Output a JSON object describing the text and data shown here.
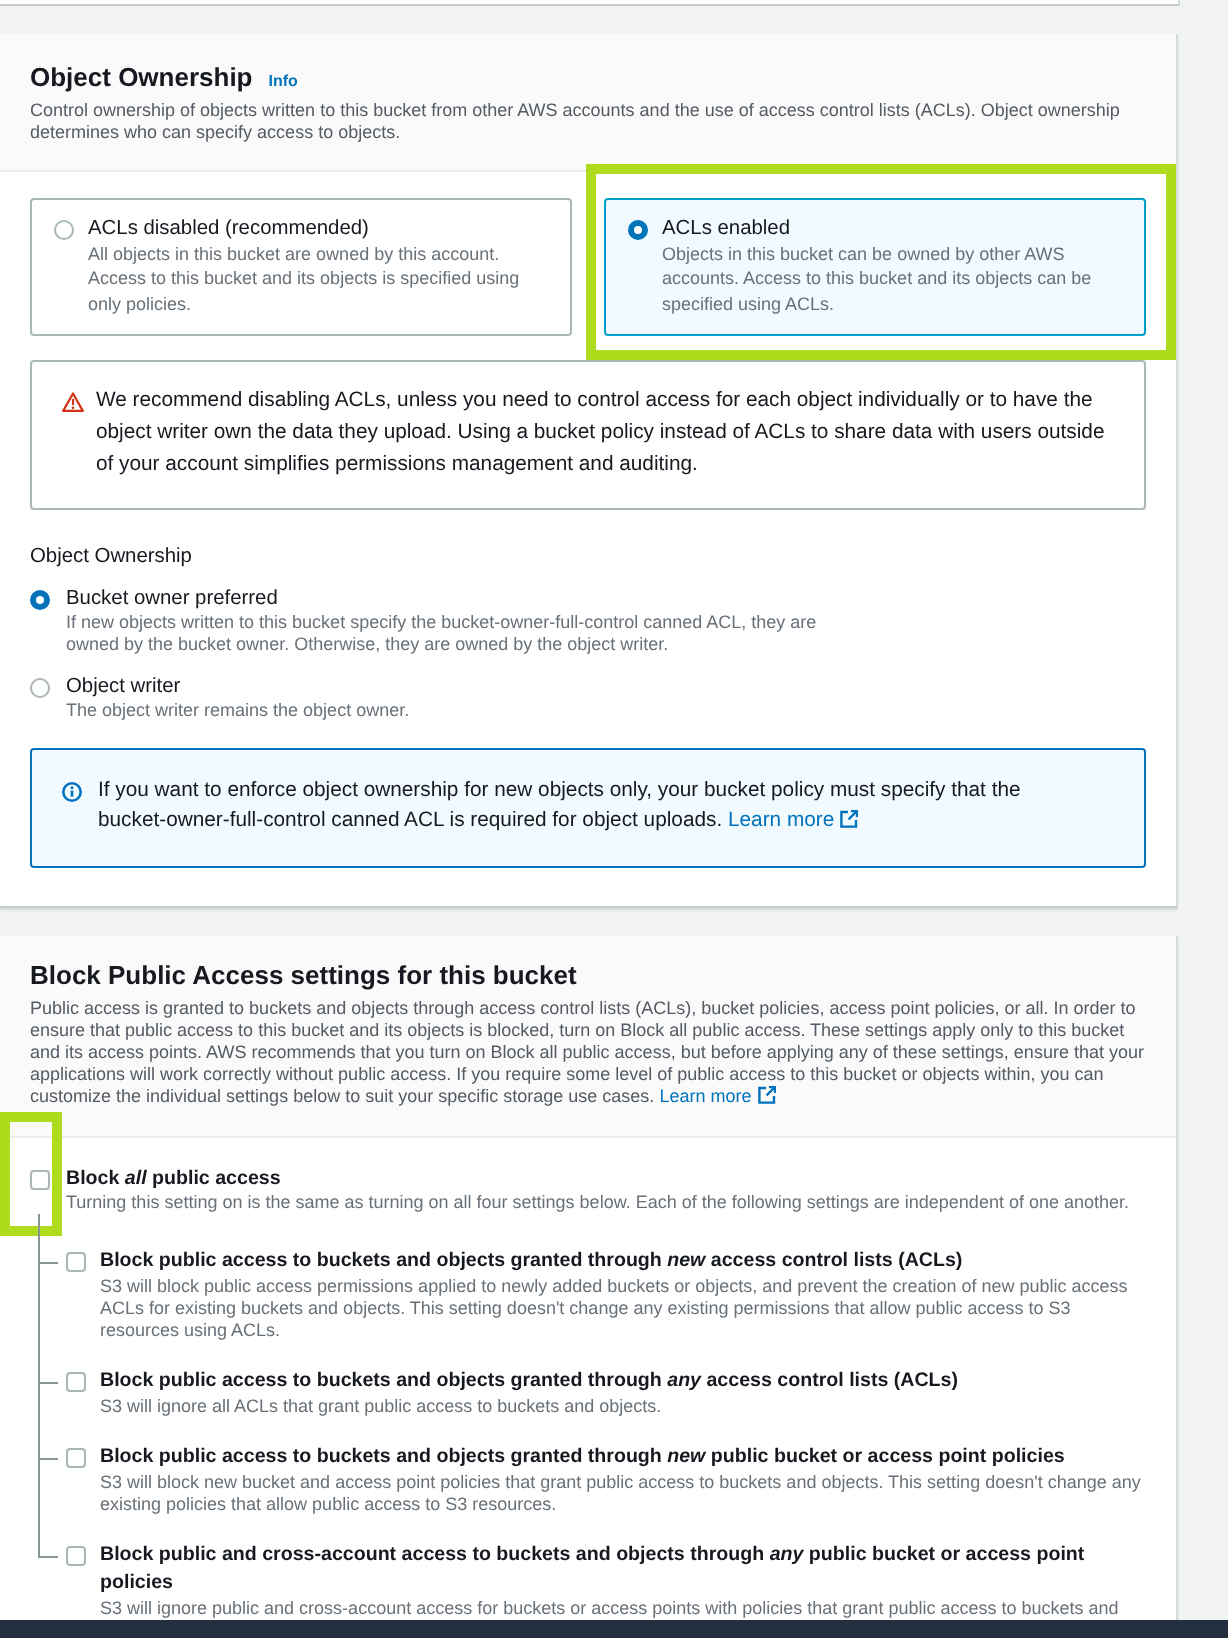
{
  "object_ownership": {
    "title": "Object Ownership",
    "info_link": "Info",
    "description": "Control ownership of objects written to this bucket from other AWS accounts and the use of access control lists (ACLs). Object ownership determines who can specify access to objects.",
    "options": [
      {
        "label": "ACLs disabled (recommended)",
        "description": "All objects in this bucket are owned by this account. Access to this bucket and its objects is specified using only policies.",
        "selected": false,
        "highlighted": false
      },
      {
        "label": "ACLs enabled",
        "description": "Objects in this bucket can be owned by other AWS accounts. Access to this bucket and its objects can be specified using ACLs.",
        "selected": true,
        "highlighted": true
      }
    ],
    "warning": "We recommend disabling ACLs, unless you need to control access for each object individually or to have the object writer own the data they upload. Using a bucket policy instead of ACLs to share data with users outside of your account simplifies permissions management and auditing.",
    "ownership_label": "Object Ownership",
    "ownership_choices": [
      {
        "label": "Bucket owner preferred",
        "description": "If new objects written to this bucket specify the bucket-owner-full-control canned ACL, they are owned by the bucket owner. Otherwise, they are owned by the object writer.",
        "selected": true
      },
      {
        "label": "Object writer",
        "description": "The object writer remains the object owner.",
        "selected": false
      }
    ],
    "info": {
      "text": "If you want to enforce object ownership for new objects only, your bucket policy must specify that the bucket-owner-full-control canned ACL is required for object uploads.",
      "link": "Learn more"
    }
  },
  "block_public_access": {
    "title": "Block Public Access settings for this bucket",
    "description": "Public access is granted to buckets and objects through access control lists (ACLs), bucket policies, access point policies, or all. In order to ensure that public access to this bucket and its objects is blocked, turn on Block all public access. These settings apply only to this bucket and its access points. AWS recommends that you turn on Block all public access, but before applying any of these settings, ensure that your applications will work correctly without public access. If you require some level of public access to this bucket or objects within, you can customize the individual settings below to suit your specific storage use cases.",
    "link": "Learn more",
    "master": {
      "label": "Block *all* public access",
      "description": "Turning this setting on is the same as turning on all four settings below. Each of the following settings are independent of one another.",
      "checked": false,
      "highlighted": true
    },
    "settings": [
      {
        "label": "Block public access to buckets and objects granted through *new* access control lists (ACLs)",
        "description": "S3 will block public access permissions applied to newly added buckets or objects, and prevent the creation of new public access ACLs for existing buckets and objects. This setting doesn't change any existing permissions that allow public access to S3 resources using ACLs.",
        "checked": false
      },
      {
        "label": "Block public access to buckets and objects granted through *any* access control lists (ACLs)",
        "description": "S3 will ignore all ACLs that grant public access to buckets and objects.",
        "checked": false
      },
      {
        "label": "Block public access to buckets and objects granted through *new* public bucket or access point policies",
        "description": "S3 will block new bucket and access point policies that grant public access to buckets and objects. This setting doesn't change any existing policies that allow public access to S3 resources.",
        "checked": false
      },
      {
        "label": "Block public and cross-account access to buckets and objects through *any* public bucket or access point policies",
        "description": "S3 will ignore public and cross-account access for buckets or access points with policies that grant public access to buckets and",
        "checked": false
      }
    ]
  }
}
